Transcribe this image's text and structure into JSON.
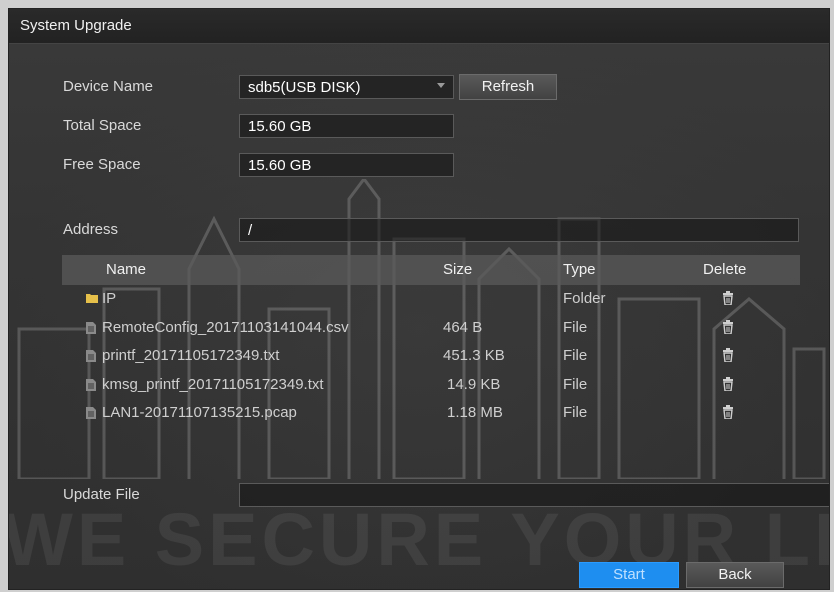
{
  "dialog": {
    "title": "System Upgrade"
  },
  "device": {
    "name_label": "Device Name",
    "name_value": "sdb5(USB DISK)",
    "refresh_label": "Refresh",
    "total_label": "Total Space",
    "total_value": "15.60 GB",
    "free_label": "Free Space",
    "free_value": "15.60 GB",
    "address_label": "Address",
    "address_value": "/"
  },
  "table": {
    "headers": {
      "name": "Name",
      "size": "Size",
      "type": "Type",
      "delete": "Delete"
    },
    "rows": [
      {
        "icon": "folder-icon",
        "name": "IP",
        "size": "",
        "type": "Folder"
      },
      {
        "icon": "file-icon",
        "name": "RemoteConfig_20171103141044.csv",
        "size": "464 B",
        "type": "File"
      },
      {
        "icon": "file-icon",
        "name": "printf_20171105172349.txt",
        "size": "451.3 KB",
        "type": "File"
      },
      {
        "icon": "file-icon",
        "name": "kmsg_printf_20171105172349.txt",
        "size": "14.9 KB",
        "type": "File"
      },
      {
        "icon": "file-icon",
        "name": "LAN1-20171107135215.pcap",
        "size": "1.18 MB",
        "type": "File"
      }
    ]
  },
  "update": {
    "label": "Update File",
    "value": ""
  },
  "footer": {
    "start_label": "Start",
    "back_label": "Back"
  },
  "watermark": "WE SECURE YOUR LIFE",
  "colors": {
    "accent": "#1e8ef0",
    "folder": "#e6c04a"
  }
}
